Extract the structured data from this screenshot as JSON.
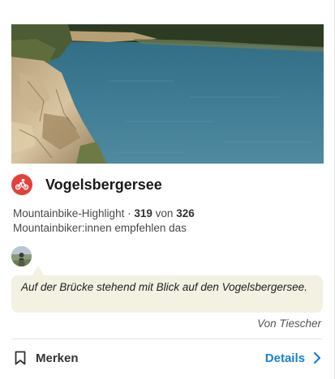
{
  "highlight": {
    "title": "Vogelsbergersee",
    "sport_icon": "mountainbike-icon",
    "category": "Mountainbike-Highlight",
    "separator": "·",
    "recommend_count": "319",
    "of_word": "von",
    "total_count": "326",
    "recommend_text": "Mountainbiker:innen empfehlen das"
  },
  "tip": {
    "text": "Auf der Brücke stehend mit Blick auf den Vogelsbergersee.",
    "author": "Von Tiescher"
  },
  "actions": {
    "save_label": "Merken",
    "details_label": "Details"
  },
  "colors": {
    "sport_badge": "#e2413a",
    "link": "#1b7fd0",
    "tip_background": "#f3f1e2"
  }
}
